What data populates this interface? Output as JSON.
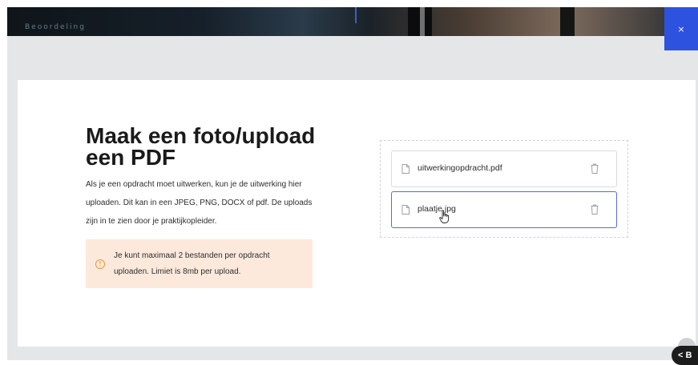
{
  "header": {
    "caption": "Beoordeling",
    "close_label": "×"
  },
  "main": {
    "title": "Maak een foto/upload een PDF",
    "description": "Als je een opdracht moet uitwerken, kun je de uitwerking hier uploaden. Dit kan in een JPEG, PNG, DOCX of pdf. De uploads zijn in te zien door je praktijkopleider.",
    "notice": {
      "icon": "warning-circle-icon",
      "icon_glyph": "!",
      "text": "Je kunt maximaal 2 bestanden per opdracht uploaden. Limiet is 8mb per upload."
    }
  },
  "uploads": {
    "files": [
      {
        "name": "uitwerkingopdracht.pdf",
        "icon": "file-icon",
        "action_icon": "trash-icon"
      },
      {
        "name": "plaatje.jpg",
        "icon": "file-icon",
        "action_icon": "trash-icon"
      }
    ]
  },
  "footer": {
    "back_label": "< B"
  },
  "colors": {
    "accent": "#2d52e0",
    "notice_bg": "#fde9dc",
    "warning": "#e59a2b",
    "selected_border": "#5a6bd3"
  }
}
